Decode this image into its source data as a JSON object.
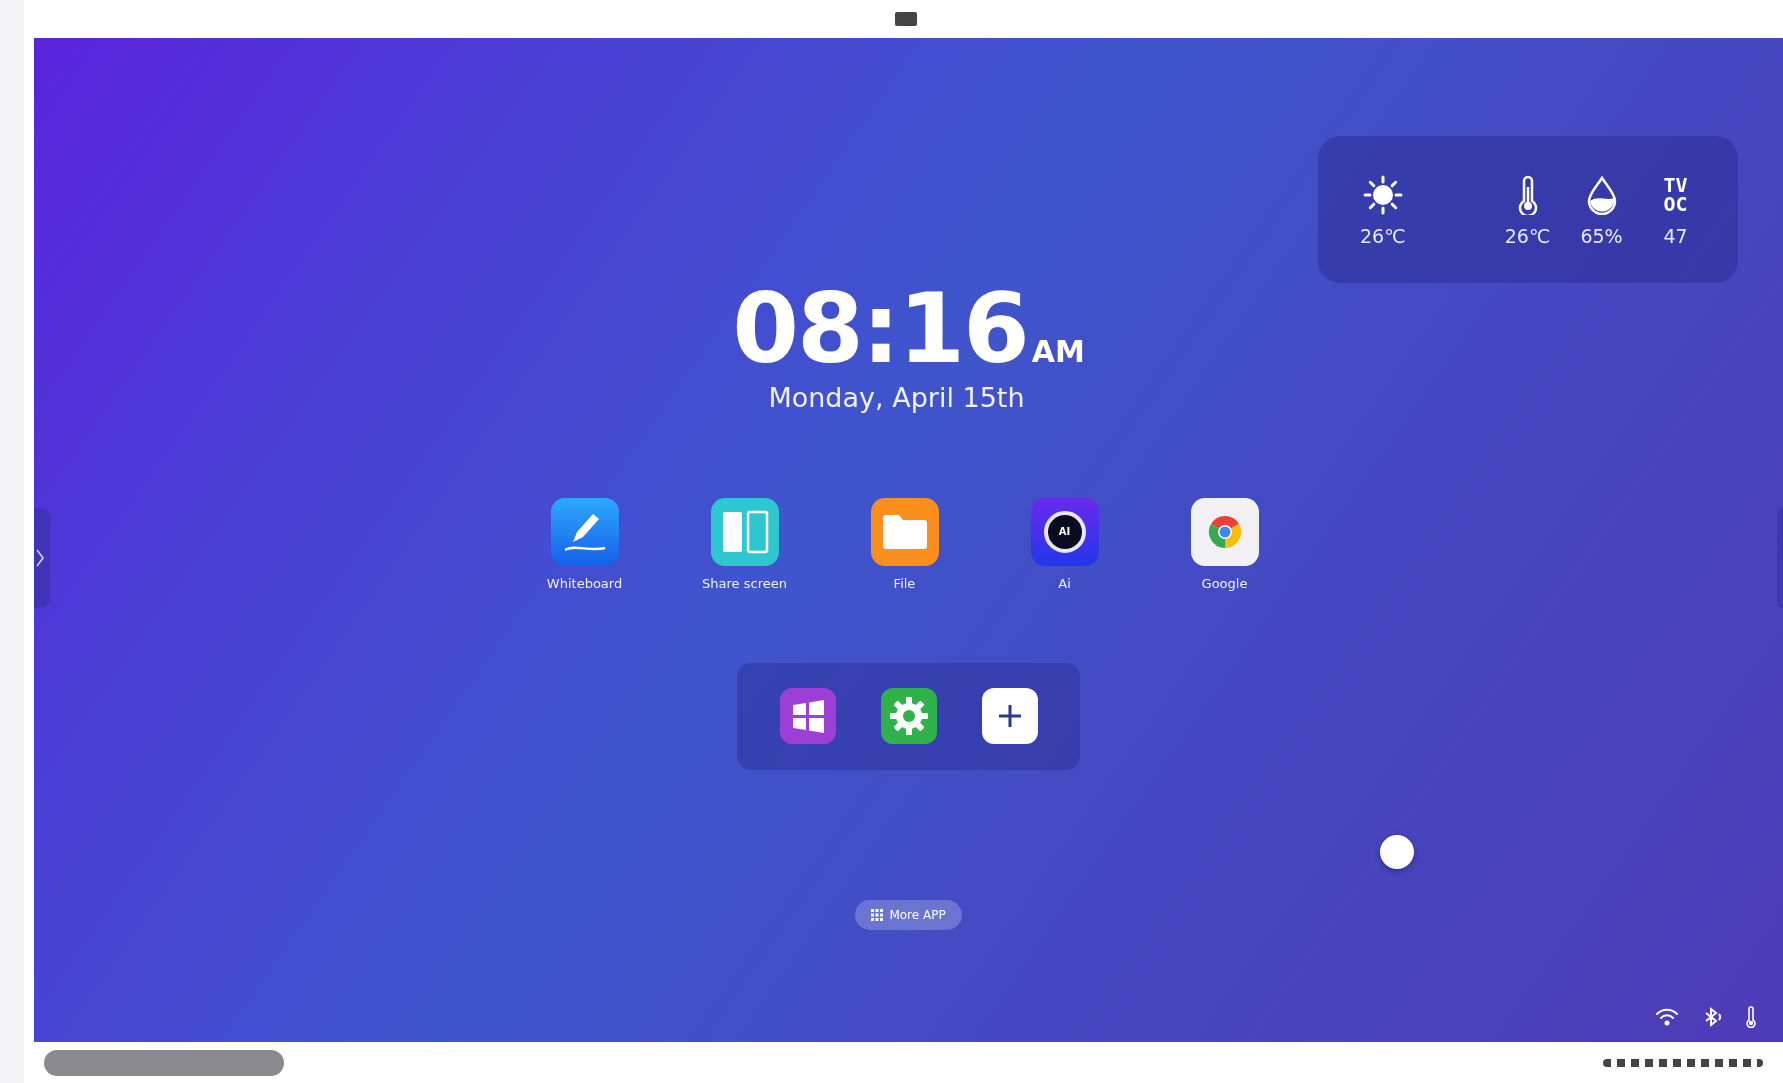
{
  "weather": {
    "outdoor": {
      "kind": "sun",
      "value": "26℃"
    },
    "indoor": [
      {
        "kind": "thermometer",
        "value": "26℃"
      },
      {
        "kind": "humidity",
        "value": "65%"
      },
      {
        "kind": "tvoc",
        "label": "TVOC",
        "value": "47"
      }
    ]
  },
  "clock": {
    "time": "08:16",
    "period": "AM",
    "date": "Monday, April 15th"
  },
  "apps": [
    {
      "kind": "whiteboard",
      "label": "Whiteboard"
    },
    {
      "kind": "share",
      "label": "Share screen"
    },
    {
      "kind": "file",
      "label": "File"
    },
    {
      "kind": "ai",
      "label": "Ai",
      "icon_text": "AI"
    },
    {
      "kind": "browser",
      "label": "Google"
    }
  ],
  "dock": [
    {
      "kind": "windows"
    },
    {
      "kind": "settings"
    },
    {
      "kind": "add"
    }
  ],
  "more_button": {
    "label": "More APP"
  },
  "status_icons": [
    {
      "kind": "wifi"
    },
    {
      "kind": "bluetooth"
    },
    {
      "kind": "thermometer"
    }
  ]
}
